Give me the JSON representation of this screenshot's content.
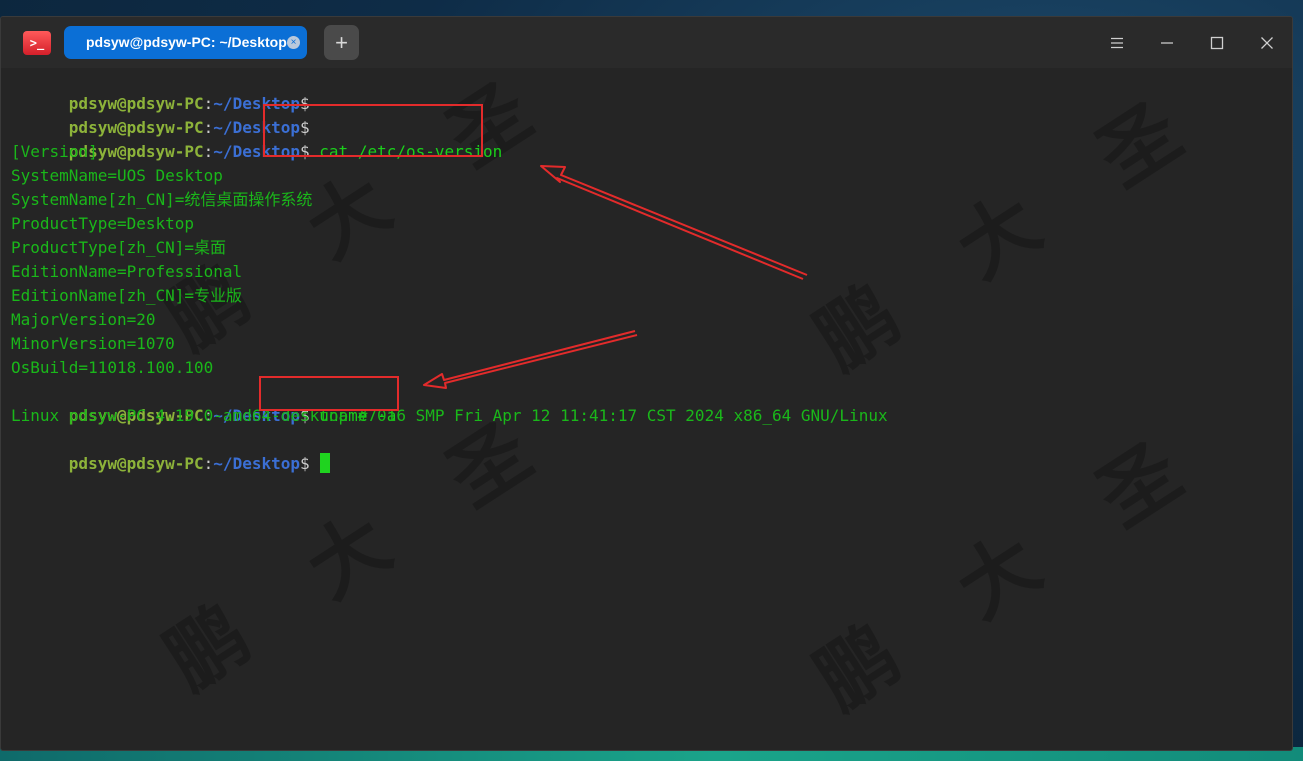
{
  "window": {
    "tab_title": "pdsyw@pdsyw-PC: ~/Desktop",
    "tab_close_glyph": "×",
    "new_tab_glyph": "+",
    "icons": {
      "app": "terminal-app-icon",
      "menu": "hamburger-menu-icon",
      "minimize": "minimize-icon",
      "maximize": "maximize-icon",
      "close": "close-icon"
    }
  },
  "prompt": {
    "user": "pdsyw@pdsyw-PC",
    "colon": ":",
    "path": "~/Desktop",
    "symbol": "$"
  },
  "terminal": {
    "cmd1": "cat /etc/os-version",
    "output1": [
      "[Version]",
      "SystemName=UOS Desktop",
      "SystemName[zh_CN]=统信桌面操作系统",
      "ProductType=Desktop",
      "ProductType[zh_CN]=桌面",
      "EditionName=Professional",
      "EditionName[zh_CN]=专业版",
      "MajorVersion=20",
      "MinorVersion=1070",
      "OsBuild=11018.100.100"
    ],
    "cmd2": "uname -a",
    "output2": "Linux pdsyw-PC 4.19.0-amd64-desktop #7016 SMP Fri Apr 12 11:41:17 CST 2024 x86_64 GNU/Linux"
  },
  "watermark": "鹏大圣",
  "colors": {
    "prompt_user": "#8db33a",
    "prompt_path": "#3b6fd4",
    "output": "#1ab71a",
    "annotation": "#e32b2b",
    "tab_active": "#0b6fd6"
  }
}
